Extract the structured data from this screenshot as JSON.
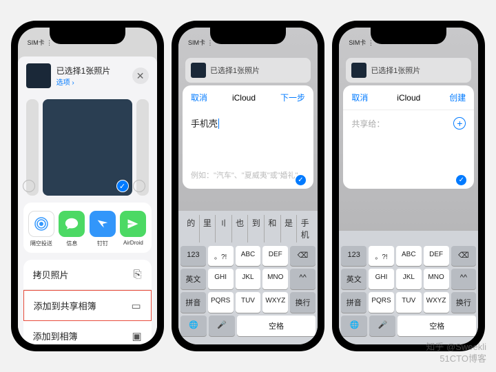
{
  "statusbar": "SIM卡 ⋮",
  "phone1": {
    "header_title": "已选择1张照片",
    "header_sub": "选项 ›",
    "apps": [
      {
        "name": "隔空投送",
        "type": "airdrop"
      },
      {
        "name": "信息",
        "type": "msg"
      },
      {
        "name": "钉钉",
        "type": "ding"
      },
      {
        "name": "AirDroid",
        "type": "air2"
      }
    ],
    "actions": [
      {
        "label": "拷贝照片",
        "icon": "⎘"
      },
      {
        "label": "添加到共享相簿",
        "icon": "▭",
        "highlight": true
      },
      {
        "label": "添加到相簿",
        "icon": "▣"
      }
    ]
  },
  "phone2": {
    "bg_title": "已选择1张照片",
    "modal": {
      "cancel": "取消",
      "title": "iCloud",
      "next": "下一步",
      "input": "手机壳",
      "placeholder": "例如：\"汽车\"、\"夏威夷\"或\"婚礼\""
    },
    "suggestions": [
      "的",
      "里",
      "〢",
      "也",
      "到",
      "和",
      "是",
      "手机"
    ],
    "keys_fn": [
      "123",
      "英文",
      "拼音"
    ],
    "keys": [
      [
        "。?!",
        "ABC",
        "DEF"
      ],
      [
        "GHI",
        "JKL",
        "MNO"
      ],
      [
        "PQRS",
        "TUV",
        "WXYZ"
      ]
    ],
    "keys_right": [
      "⌫",
      "^^",
      "换行"
    ],
    "space": "空格"
  },
  "phone3": {
    "bg_title": "已选择1张照片",
    "modal": {
      "cancel": "取消",
      "title": "iCloud",
      "create": "创建",
      "share_label": "共享给："
    },
    "keys_fn": [
      "123",
      "英文",
      "拼音"
    ],
    "keys": [
      [
        "。?!",
        "ABC",
        "DEF"
      ],
      [
        "GHI",
        "JKL",
        "MNO"
      ],
      [
        "PQRS",
        "TUV",
        "WXYZ"
      ]
    ],
    "keys_right": [
      "⌫",
      "^^",
      "换行"
    ],
    "space": "空格"
  },
  "watermark": {
    "line1": "知乎 @Sweekli",
    "line2": "51CTO博客"
  }
}
